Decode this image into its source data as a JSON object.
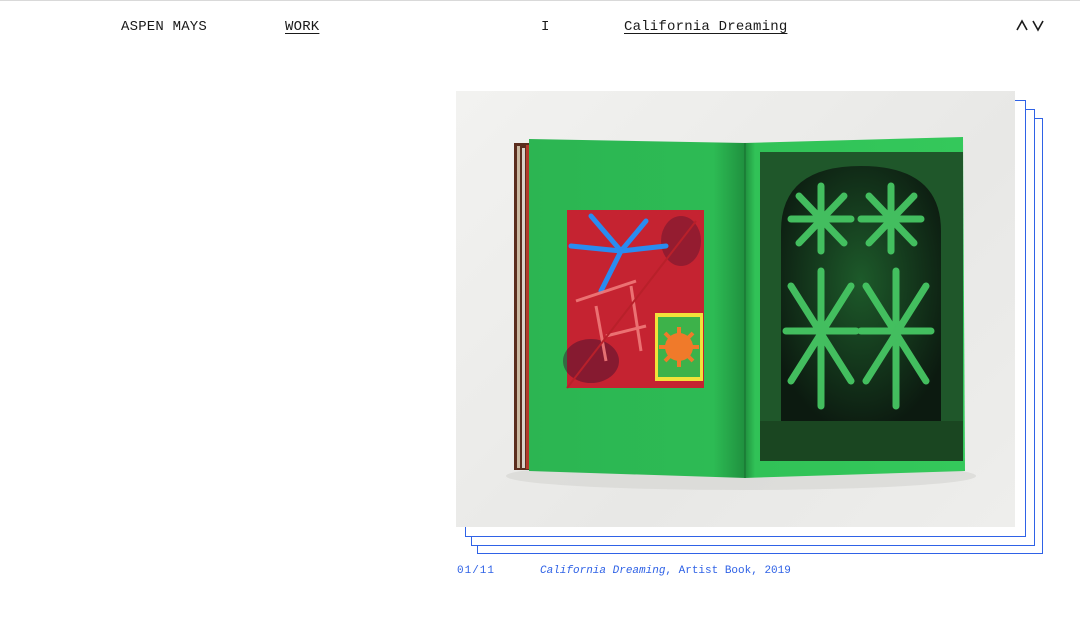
{
  "header": {
    "site_title": "ASPEN MAYS",
    "nav_work": "WORK",
    "separator": "I",
    "project_title": "California Dreaming",
    "prev_label": "previous project",
    "next_label": "next project"
  },
  "image": {
    "alt": "Open artist book with green pages showing a red abstract print and a green photographic print of a window"
  },
  "caption": {
    "counter": "01/11",
    "title": "California Dreaming",
    "details": ", Artist Book, 2019"
  },
  "colors": {
    "accent": "#2f62e6",
    "page_green": "#2fbf55",
    "text": "#1a1a1a"
  }
}
